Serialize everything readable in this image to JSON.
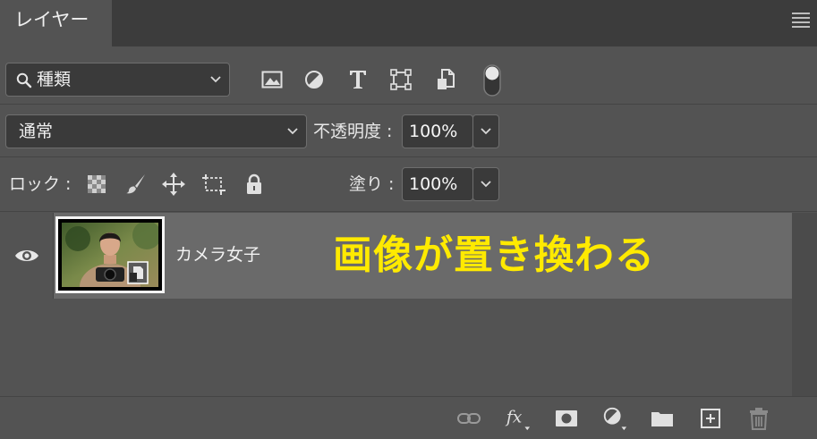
{
  "panel": {
    "tab_label": "レイヤー"
  },
  "filter": {
    "kind_label": "種類",
    "icons": [
      "pixel-filter-icon",
      "adjustment-filter-icon",
      "type-filter-icon",
      "shape-filter-icon",
      "smart-object-filter-icon",
      "filter-toggle-icon"
    ]
  },
  "blend": {
    "mode": "通常",
    "opacity_label": "不透明度 :",
    "opacity_value": "100%"
  },
  "lock": {
    "label": "ロック :",
    "fill_label": "塗り :",
    "fill_value": "100%",
    "icons": [
      "lock-transparent-icon",
      "lock-paint-icon",
      "lock-position-icon",
      "lock-artboard-icon",
      "lock-all-icon"
    ]
  },
  "layers": [
    {
      "name": "カメラ女子",
      "visible": true,
      "type": "smart-object"
    }
  ],
  "annotation": {
    "text": "画像が置き換わる",
    "color": "#ffea00"
  },
  "footer": {
    "icons": [
      "link-layers-icon",
      "fx-icon",
      "layer-mask-icon",
      "adjustment-layer-icon",
      "group-folder-icon",
      "new-layer-icon",
      "trash-icon"
    ]
  },
  "colors": {
    "panel_bg": "#535353",
    "selected_layer_bg": "#6a6a6a"
  }
}
